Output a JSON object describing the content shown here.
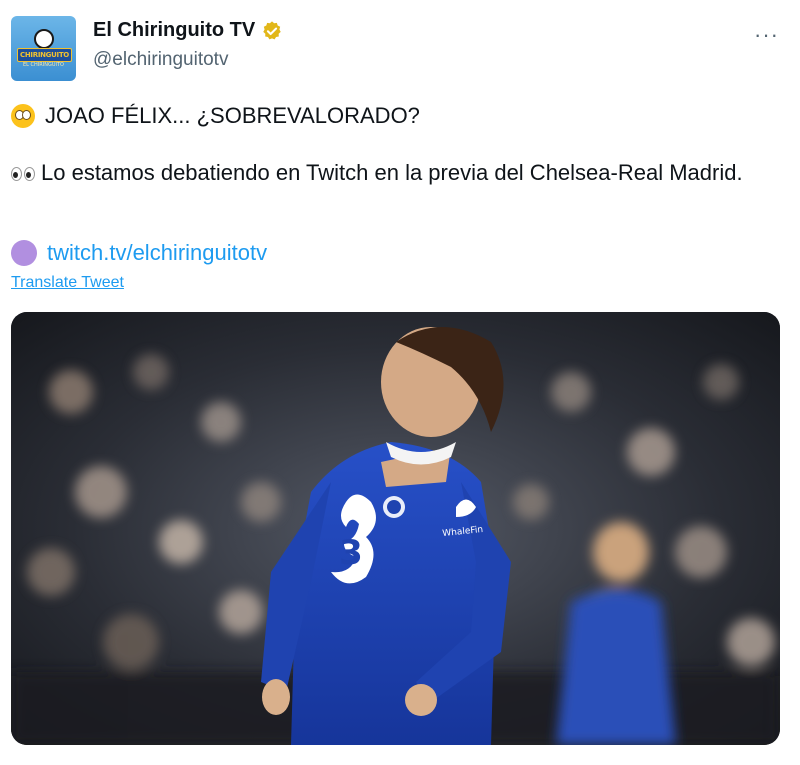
{
  "tweet": {
    "display_name": "El Chiringuito TV",
    "handle": "@elchiringuitotv",
    "avatar_text": "CHIRINGUITO",
    "avatar_subtext": "EL CHIRINGUITO",
    "more_label": "···",
    "line1": "JOAO FÉLIX... ¿SOBREVALORADO?",
    "line2": "Lo estamos debatiendo en Twitch en la previa del Chelsea-Real Madrid.",
    "link": "twitch.tv/elchiringuitotv",
    "translate_label": "Translate Tweet"
  },
  "media": {
    "shirt_text": "WhaleFin",
    "sponsor_number": "3"
  },
  "colors": {
    "link": "#1d9bf0",
    "verified": "#e2b719",
    "jersey": "#1e3fa8"
  }
}
